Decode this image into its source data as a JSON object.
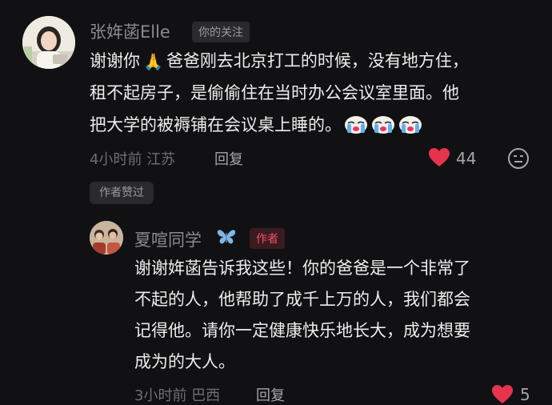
{
  "comment": {
    "username": "张姩菡Elle",
    "relation_tag": "你的关注",
    "text_line1_a": "谢谢你",
    "text_line1_emoji": "pray-emoji",
    "text_line1_b": "爸爸刚去北京打工的时候，没有地方住，",
    "text_line2": "租不起房子，是偷偷住在当时办公会议室里面。他",
    "text_line3": "把大学的被褥铺在会议桌上睡的。",
    "text_line3_emojis": [
      "crying-emoji",
      "crying-emoji",
      "crying-emoji"
    ],
    "time": "4小时前",
    "location": "江苏",
    "reply_label": "回复",
    "like_count": "44",
    "liked_badge": "作者赞过"
  },
  "reply": {
    "username": "夏喧同学",
    "username_emoji": "butterfly-icon",
    "author_tag": "作者",
    "text_line1": "谢谢姩菡告诉我这些！你的爸爸是一个非常了",
    "text_line2": "不起的人，他帮助了成千上万的人，我们都会",
    "text_line3": "记得他。请你一定健康快乐地长大，成为想要",
    "text_line4": "成为的大人。",
    "time": "3小时前",
    "location": "巴西",
    "reply_label": "回复",
    "like_count": "5"
  },
  "colors": {
    "background": "#111113",
    "like_red": "#e8334f",
    "author_tag": "#f0506a",
    "butterfly": "#7fb6e6"
  }
}
